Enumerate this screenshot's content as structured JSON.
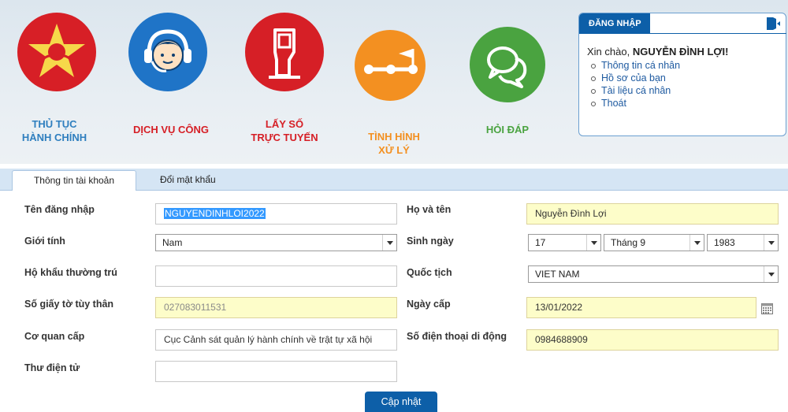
{
  "services": [
    {
      "label_line1": "THỦ TỤC",
      "label_line2": "HÀNH CHÍNH",
      "color": "#2f7fbf"
    },
    {
      "label_line1": "DỊCH VỤ CÔNG",
      "label_line2": "",
      "color": "#d61f26"
    },
    {
      "label_line1": "LẤY SỐ",
      "label_line2": "TRỰC TUYẾN",
      "color": "#d61f26"
    },
    {
      "label_line1": "TÌNH HÌNH",
      "label_line2": "XỬ LÝ",
      "color": "#f39021"
    },
    {
      "label_line1": "HỎI ĐÁP",
      "label_line2": "",
      "color": "#4aa340"
    }
  ],
  "login": {
    "tab_label": "ĐĂNG NHẬP",
    "greeting": "Xin chào,",
    "user_name": "NGUYỄN ĐÌNH LỢI!",
    "links": [
      "Thông tin cá nhân",
      "Hồ sơ của bạn",
      "Tài liệu cá nhân",
      "Thoát"
    ]
  },
  "tabs": [
    "Thông tin tài khoản",
    "Đổi mật khẩu"
  ],
  "form": {
    "username_label": "Tên đăng nhập",
    "username_value": "NGUYENDINHLOI2022",
    "fullname_label": "Họ và tên",
    "fullname_value": "Nguyễn Đình Lợi",
    "gender_label": "Giới tính",
    "gender_value": "Nam",
    "dob_label": "Sinh ngày",
    "dob_day": "17",
    "dob_month": "Tháng 9",
    "dob_year": "1983",
    "residence_label": "Hộ khẩu thường trú",
    "residence_value": "",
    "nationality_label": "Quốc tịch",
    "nationality_value": "VIET NAM",
    "id_label": "Số giấy tờ tùy thân",
    "id_value": "027083011531",
    "issue_date_label": "Ngày cấp",
    "issue_date_value": "13/01/2022",
    "issuer_label": "Cơ quan cấp",
    "issuer_value": "Cục Cảnh sát quản lý hành chính về trật tự xã hội",
    "phone_label": "Số điện thoại di động",
    "phone_value": "0984688909",
    "email_label": "Thư điện tử",
    "email_value": ""
  },
  "update_button": "Cập nhật"
}
